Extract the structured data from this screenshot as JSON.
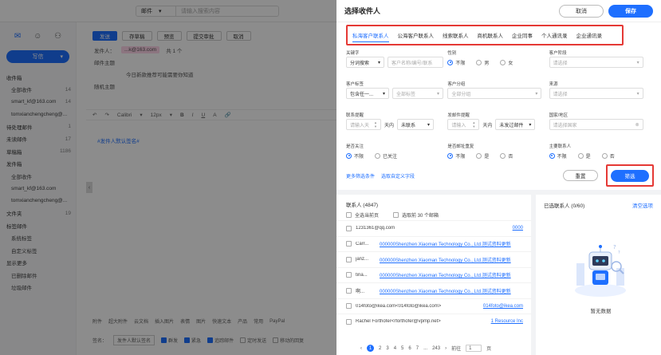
{
  "app": {
    "top_search": {
      "select": "邮件",
      "placeholder": "请输入搜索内容"
    },
    "sidebar": {
      "write_label": "写信",
      "folders": [
        {
          "label": "收件箱",
          "count": "",
          "kind": "head"
        },
        {
          "label": "全部收件",
          "count": "14",
          "kind": "sub"
        },
        {
          "label": "smart_kf@163.com",
          "count": "14",
          "kind": "sub"
        },
        {
          "label": "tomxianchengcheng@...",
          "count": "",
          "kind": "sub"
        },
        {
          "label": "待处理邮件",
          "count": "1",
          "kind": "head"
        },
        {
          "label": "未读邮件",
          "count": "17",
          "kind": "head"
        },
        {
          "label": "草稿箱",
          "count": "1186",
          "kind": "head"
        },
        {
          "label": "发件箱",
          "count": "",
          "kind": "head"
        },
        {
          "label": "全部收件",
          "count": "",
          "kind": "sub"
        },
        {
          "label": "smart_kf@163.com",
          "count": "",
          "kind": "sub"
        },
        {
          "label": "tomxianchengcheng@...",
          "count": "",
          "kind": "sub"
        },
        {
          "label": "文件夹",
          "count": "19",
          "kind": "head"
        },
        {
          "label": "标签邮件",
          "count": "",
          "kind": "head"
        },
        {
          "label": "系统标签",
          "count": "",
          "kind": "sub"
        },
        {
          "label": "自定义标签",
          "count": "",
          "kind": "sub"
        },
        {
          "label": "显示更多",
          "count": "",
          "kind": "head"
        },
        {
          "label": "已删除邮件",
          "count": "",
          "kind": "sub"
        },
        {
          "label": "垃圾邮件",
          "count": "",
          "kind": "sub"
        }
      ]
    },
    "compose": {
      "toolbar": [
        "发送",
        "存草稿",
        "预览",
        "提交审批",
        "取消"
      ],
      "from_label": "发件人：",
      "from_value": "...k@163.com",
      "count_badge": "共 1 个",
      "subject_label": "邮件主题",
      "subject_value": "今日新款推荐可能需要你知道",
      "extra_label": "随机主题",
      "font_name": "Calibri",
      "font_size": "12px",
      "edit_icons": [
        "B",
        "I",
        "U",
        "A"
      ],
      "placeholder_link": "#发件人默认签名#",
      "bottom_items": [
        "附件",
        "超大附件",
        "云文档",
        "插入图片",
        "表情",
        "图片",
        "快速文本",
        "产品",
        "常用",
        "PayPal"
      ],
      "bottom2": {
        "label": "签名：",
        "value": "发件人默认签名",
        "opts": [
          "群发",
          "紧急",
          "追踪邮件",
          "定时发送",
          "移动的回复"
        ]
      }
    }
  },
  "modal": {
    "title": "选择收件人",
    "cancel_label": "取消",
    "save_label": "保存",
    "tabs": [
      "私海客户联系人",
      "公海客户联系人",
      "线索联系人",
      "商机联系人",
      "企业同事",
      "个人通讯录",
      "企业通讯录"
    ],
    "filters": {
      "keyword": {
        "label": "关键字",
        "select": "分词搜索",
        "placeholder": "客户名称/编号/联系"
      },
      "gender": {
        "label": "性别",
        "options": [
          "不限",
          "男",
          "女"
        ]
      },
      "customer_level": {
        "label": "客户阶段",
        "placeholder": "请选择"
      },
      "customer_tag": {
        "label": "客户标签",
        "select": "包含任一...",
        "placeholder": "全部标签"
      },
      "customer_group": {
        "label": "客户分组",
        "placeholder": "全部分组"
      },
      "source": {
        "label": "来源",
        "placeholder": "请选择"
      },
      "contact_reminder": {
        "label": "联系提醒",
        "placeholder": "请输入天",
        "unit": "天内",
        "select": "未联系"
      },
      "send_reminder": {
        "label": "发邮件提醒",
        "placeholder": "请输入",
        "unit": "天内",
        "select": "未发过邮件"
      },
      "country": {
        "label": "国家/地区",
        "placeholder": "请选择国家"
      },
      "starred": {
        "label": "是否关注",
        "options": [
          "不限",
          "已关注"
        ]
      },
      "dedupe": {
        "label": "是否邮址重复",
        "options": [
          "不限",
          "是",
          "否"
        ]
      },
      "main_contact": {
        "label": "主要联系人",
        "options": [
          "不限",
          "是",
          "否"
        ]
      }
    },
    "more_filters": "更多筛选条件",
    "custom_fields": "选取自定义字段",
    "reset_label": "重置",
    "filter_label": "筛选",
    "contacts": {
      "title": "联系人 (4847)",
      "select_page": "全选当前页",
      "select_first": "选取前 30 个邮箱",
      "items": [
        {
          "name": "1231361@qq.com",
          "org": "0000",
          "wide": true
        },
        {
          "name": "Carr...",
          "org": "000000Shenzhen Xiaoman Technology Co., Ltd.测试资料更新",
          "wide": false
        },
        {
          "name": "janz...",
          "org": "000000Shenzhen Xiaoman Technology Co., Ltd.测试资料更新",
          "wide": false
        },
        {
          "name": "tina...",
          "org": "000000Shenzhen Xiaoman Technology Co., Ltd.测试资料更新",
          "wide": false
        },
        {
          "name": "啊...",
          "org": "000000Shenzhen Xiaoman Technology Co., Ltd.测试资料更新",
          "wide": false
        },
        {
          "name": "014foto@ikea.com<014foto@ikea.com>",
          "org": "014foto@ikea.com",
          "wide": true
        },
        {
          "name": "Rachel Forthofer<rforthofer@vpmp.net>",
          "org": "1 Resource Inc",
          "wide": true
        }
      ],
      "pager": {
        "pages": [
          "1",
          "2",
          "3",
          "4",
          "5",
          "6",
          "7",
          "...",
          "243"
        ],
        "current": "1",
        "goto_label": "前往",
        "goto_value": "1",
        "goto_unit": "页"
      }
    },
    "selected": {
      "title": "已选联系人 (0/60)",
      "clear_label": "清空选项",
      "empty_text": "暂无数据"
    }
  }
}
